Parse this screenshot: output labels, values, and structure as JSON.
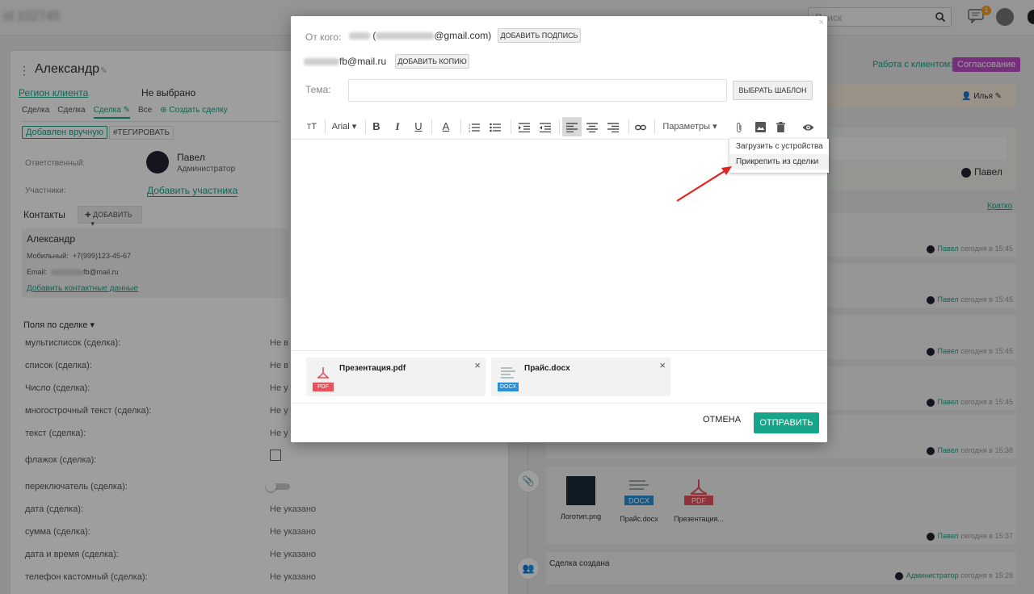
{
  "background": {
    "search_placeholder": "Поиск",
    "chat_badge": "1",
    "deal": {
      "title": "Александр",
      "region_label": "Регион клиента",
      "region_value": "Не выбрано",
      "tabs": [
        "Сделка",
        "Сделка",
        "Сделка",
        "Все"
      ],
      "create_deal": "Создать сделку",
      "added_manually": "Добавлен вручную",
      "tag_button": "#ТЕГИРОВАТЬ",
      "responsible_label": "Ответственный:",
      "responsible_name": "Павел",
      "responsible_role": "Администратор",
      "participants_label": "Участники:",
      "add_participant": "Добавить участника",
      "contacts_label": "Контакты",
      "contacts_add": "ДОБАВИТЬ",
      "contact": {
        "name": "Александр",
        "phone_label": "Мобильный:",
        "phone": "+7(999)123-45-67",
        "email_label": "Email:",
        "email_visible": "fb@mail.ru",
        "add_contact_data": "Добавить контактные данные"
      },
      "fields_label": "Поля по сделке",
      "fields": [
        {
          "label": "мультисписок (сделка):",
          "value": "Не в"
        },
        {
          "label": "список (сделка):",
          "value": "Не в"
        },
        {
          "label": "Число (сделка):",
          "value": "Не у"
        },
        {
          "label": "многострочный текст (сделка):",
          "value": "Не у"
        },
        {
          "label": "текст (сделка):",
          "value": "Не у"
        },
        {
          "label": "флажок (сделка):",
          "value": ""
        },
        {
          "label": "переключатель (сделка):",
          "value": ""
        },
        {
          "label": "дата (сделка):",
          "value": "Не указано"
        },
        {
          "label": "сумма (сделка):",
          "value": "Не указано"
        },
        {
          "label": "дата и время (сделка):",
          "value": "Не указано"
        },
        {
          "label": "телефон кастомный (сделка):",
          "value": "Не указано"
        }
      ]
    },
    "right_panel": {
      "work_label": "Работа с клиентом:",
      "status": "Согласование",
      "user_ilya": "Илья",
      "user_pavel": "Павел",
      "short_link": "Кратко",
      "entries": [
        {
          "author": "Павел",
          "time": "сегодня в 15:45"
        },
        {
          "author": "Павел",
          "time": "сегодня в 15:45"
        },
        {
          "author": "Павел",
          "time": "сегодня в 15:45"
        },
        {
          "author": "Павел",
          "time": "сегодня в 15:45"
        },
        {
          "author": "Павел",
          "time": "сегодня в 15:38"
        }
      ],
      "files": [
        {
          "name": "Логотип.png"
        },
        {
          "name": "Прайс.docx",
          "ext": "DOCX"
        },
        {
          "name": "Презентация...",
          "ext": "PDF"
        }
      ],
      "files_meta": {
        "author": "Павел",
        "time": "сегодня в 15:37"
      },
      "created": {
        "label": "Сделка создана",
        "author": "Администратор",
        "time": "сегодня в 15:28"
      }
    }
  },
  "modal": {
    "from_label": "От кого:",
    "from_email_suffix": "@gmail.com)",
    "add_signature": "ДОБАВИТЬ ПОДПИСЬ",
    "cc_email_suffix": "fb@mail.ru",
    "add_copy": "ДОБАВИТЬ КОПИЮ",
    "subject_label": "Тема:",
    "subject_value": "",
    "choose_template": "ВЫБРАТЬ ШАБЛОН",
    "toolbar": {
      "font": "Arial",
      "params": "Параметры"
    },
    "attach_menu": {
      "from_device": "Загрузить с устройства",
      "from_deal": "Прикрепить из сделки"
    },
    "attachments": [
      {
        "name": "Презентация.pdf",
        "ext": "PDF"
      },
      {
        "name": "Прайс.docx",
        "ext": "DOCX"
      }
    ],
    "cancel": "ОТМЕНА",
    "send": "ОТПРАВИТЬ"
  },
  "colors": {
    "accent": "#17a589",
    "status": "#c04bc8",
    "annotation_arrow": "#e32222"
  }
}
